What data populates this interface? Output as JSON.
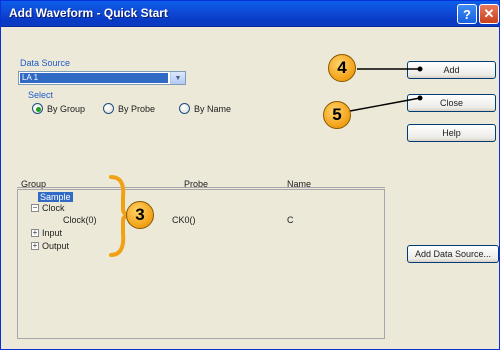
{
  "window": {
    "title": "Add Waveform - Quick Start",
    "help_glyph": "?",
    "close_glyph": "✕"
  },
  "data_source": {
    "label": "Data Source",
    "value": "LA 1",
    "arrow": "▼"
  },
  "select": {
    "label": "Select",
    "options": [
      {
        "label": "By Group",
        "checked": true
      },
      {
        "label": "By Probe",
        "checked": false
      },
      {
        "label": "By Name",
        "checked": false
      }
    ]
  },
  "table": {
    "headers": {
      "group": "Group",
      "probe": "Probe",
      "name": "Name"
    },
    "rows": [
      {
        "group": "Sample",
        "expander": "",
        "selected": true,
        "probe": "",
        "name": ""
      },
      {
        "group": "Clock",
        "expander": "−",
        "selected": false,
        "probe": "",
        "name": ""
      },
      {
        "group": "Clock(0)",
        "expander": "",
        "selected": false,
        "probe": "CK0()",
        "name": "C"
      },
      {
        "group": "Input",
        "expander": "+",
        "selected": false,
        "probe": "",
        "name": ""
      },
      {
        "group": "Output",
        "expander": "+",
        "selected": false,
        "probe": "",
        "name": ""
      }
    ]
  },
  "buttons": {
    "add": "Add",
    "close": "Close",
    "help": "Help",
    "add_data_source": "Add Data Source..."
  },
  "callouts": [
    "4",
    "5",
    "3"
  ],
  "colors": {
    "callout_fill": "#f2a014",
    "title_bar": "#0a5ee8",
    "selection": "#316ac5"
  }
}
